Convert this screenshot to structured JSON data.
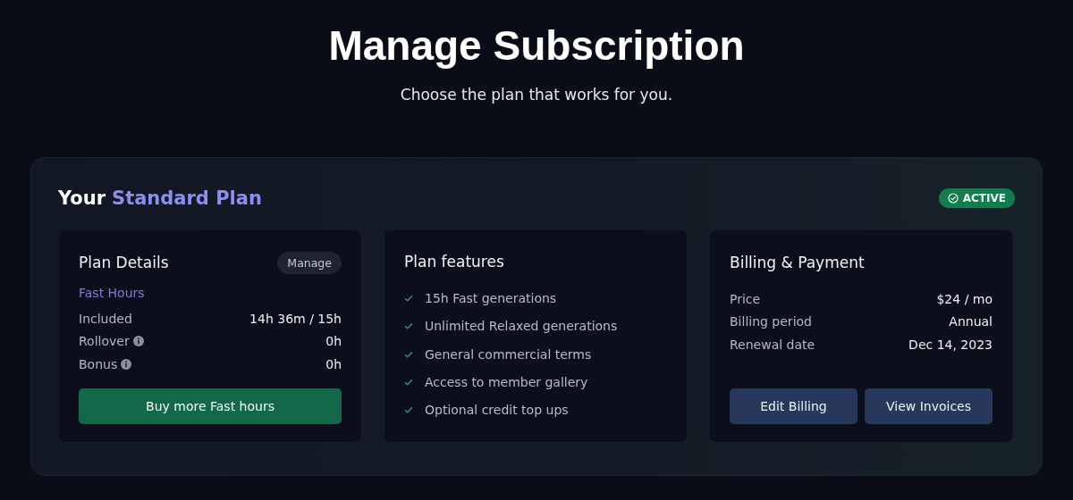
{
  "page": {
    "title": "Manage Subscription",
    "subtitle": "Choose the plan that works for you."
  },
  "plan": {
    "title_prefix": "Your",
    "plan_name": "Standard Plan",
    "status": {
      "label": "ACTIVE",
      "active": true
    }
  },
  "plan_details": {
    "title": "Plan Details",
    "manage_button": "Manage",
    "section": "Fast Hours",
    "rows": [
      {
        "label": "Included",
        "value": "14h 36m / 15h",
        "info": false
      },
      {
        "label": "Rollover",
        "value": "0h",
        "info": true
      },
      {
        "label": "Bonus",
        "value": "0h",
        "info": true
      }
    ],
    "button": "Buy more Fast hours"
  },
  "plan_features": {
    "title": "Plan features",
    "items": [
      "15h Fast generations",
      "Unlimited Relaxed generations",
      "General commercial terms",
      "Access to member gallery",
      "Optional credit top ups"
    ]
  },
  "billing": {
    "title": "Billing & Payment",
    "rows": [
      {
        "label": "Price",
        "value": "$24 / mo"
      },
      {
        "label": "Billing period",
        "value": "Annual"
      },
      {
        "label": "Renewal date",
        "value": "Dec 14, 2023"
      }
    ],
    "buttons": [
      "Edit Billing",
      "View Invoices"
    ]
  }
}
